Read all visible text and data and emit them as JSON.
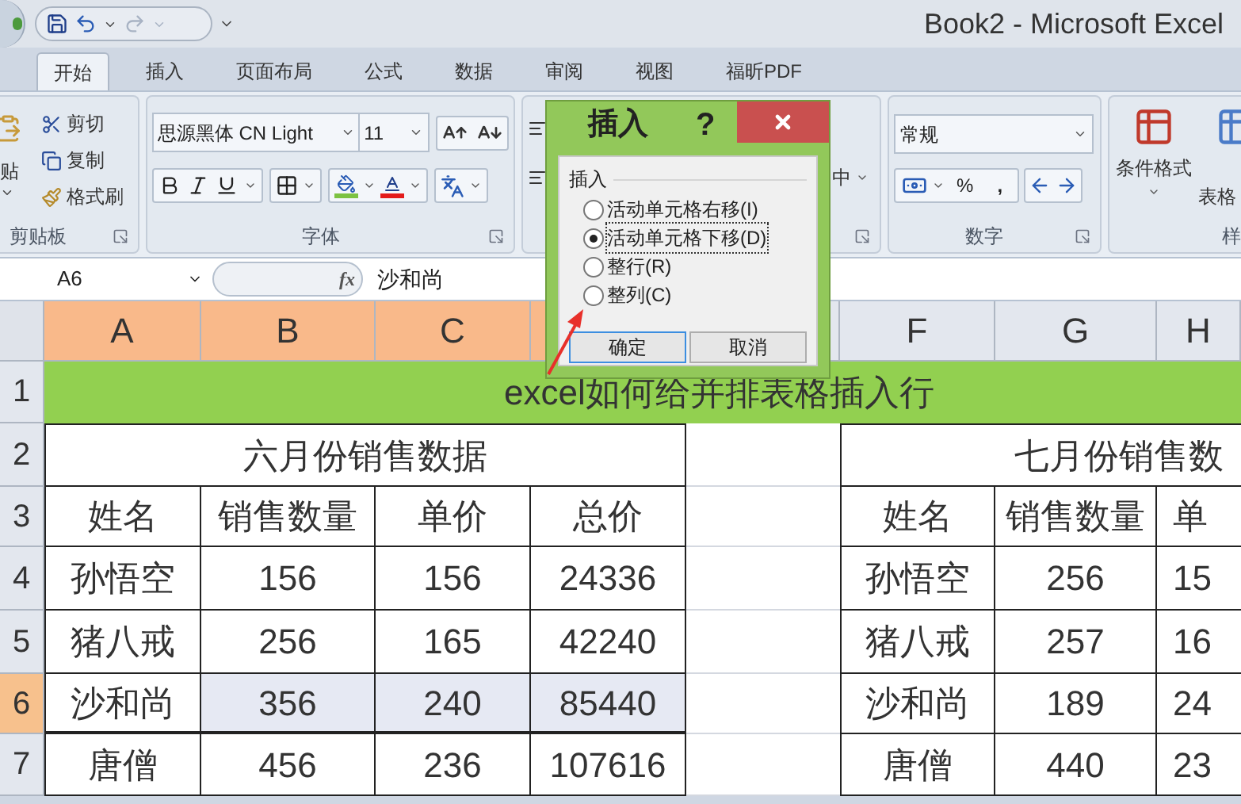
{
  "title_bar": {
    "title": "Book2 - Microsoft Excel"
  },
  "tabs": [
    {
      "label": "开始",
      "selected": true
    },
    {
      "label": "插入",
      "selected": false
    },
    {
      "label": "页面布局",
      "selected": false
    },
    {
      "label": "公式",
      "selected": false
    },
    {
      "label": "数据",
      "selected": false
    },
    {
      "label": "审阅",
      "selected": false
    },
    {
      "label": "视图",
      "selected": false
    },
    {
      "label": "福昕PDF",
      "selected": false
    }
  ],
  "ribbon": {
    "clipboard": {
      "paste_label": "贴",
      "items": [
        "剪切",
        "复制",
        "格式刷"
      ],
      "group_label": "剪贴板"
    },
    "font": {
      "font_name": "思源黑体 CN Light",
      "font_size": "11",
      "group_label": "字体"
    },
    "alignment": {
      "merge_label": "中"
    },
    "number": {
      "format": "常规",
      "percent": "%",
      "comma": ",",
      "group_label": "数字"
    },
    "styles": {
      "conditional_format": "条件格式",
      "table_format": "表格",
      "group_label": "样"
    }
  },
  "formula_bar": {
    "name_box": "A6",
    "fx": "fx",
    "formula": "沙和尚"
  },
  "sheet": {
    "columns": [
      {
        "label": "A",
        "selected": true
      },
      {
        "label": "B",
        "selected": true
      },
      {
        "label": "C",
        "selected": true
      },
      {
        "selected": true
      },
      {
        "selected": false
      },
      {
        "label": "F",
        "selected": false
      },
      {
        "label": "G",
        "selected": false
      },
      {
        "label": "H",
        "selected": false
      }
    ],
    "rows": [
      {
        "label": "1",
        "selected": false
      },
      {
        "label": "2",
        "selected": false
      },
      {
        "label": "3",
        "selected": false
      },
      {
        "label": "4",
        "selected": false
      },
      {
        "label": "5",
        "selected": false
      },
      {
        "label": "6",
        "selected": true
      },
      {
        "label": "7",
        "selected": false
      }
    ],
    "title": "excel如何给并排表格插入行",
    "tables": [
      {
        "caption": "六月份销售数据",
        "header": [
          "姓名",
          "销售数量",
          "单价",
          "总价"
        ],
        "rows": [
          {
            "cells": [
              "孙悟空",
              "156",
              "156",
              "24336"
            ],
            "selected": false
          },
          {
            "cells": [
              "猪八戒",
              "256",
              "165",
              "42240"
            ],
            "selected": false
          },
          {
            "cells": [
              "沙和尚",
              "356",
              "240",
              "85440"
            ],
            "selected": true
          },
          {
            "cells": [
              "唐僧",
              "456",
              "236",
              "107616"
            ],
            "selected": false
          }
        ]
      },
      {
        "caption": "七月份销售数",
        "header": [
          "姓名",
          "销售数量",
          "单"
        ],
        "rows": [
          {
            "cells": [
              "孙悟空",
              "256",
              "15"
            ],
            "selected": false
          },
          {
            "cells": [
              "猪八戒",
              "257",
              "16"
            ],
            "selected": false
          },
          {
            "cells": [
              "沙和尚",
              "189",
              "24"
            ],
            "selected": false
          },
          {
            "cells": [
              "唐僧",
              "440",
              "23"
            ],
            "selected": false
          }
        ]
      }
    ]
  },
  "dialog": {
    "title": "插入",
    "help": "?",
    "group_label": "插入",
    "options": [
      {
        "label": "活动单元格右移(I)",
        "selected": false
      },
      {
        "label": "活动单元格下移(D)",
        "selected": true
      },
      {
        "label": "整行(R)",
        "selected": false
      },
      {
        "label": "整列(C)",
        "selected": false
      }
    ],
    "buttons": [
      "确定",
      "取消"
    ]
  }
}
